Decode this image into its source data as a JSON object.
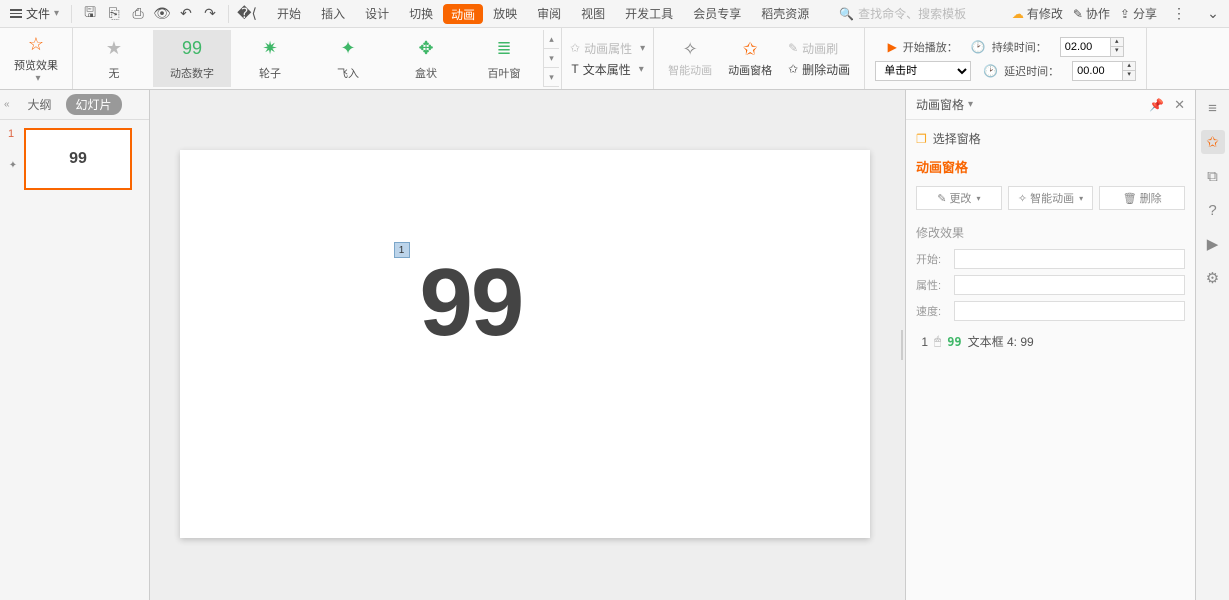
{
  "topbar": {
    "file": "文件",
    "tabs": [
      "开始",
      "插入",
      "设计",
      "切换",
      "动画",
      "放映",
      "审阅",
      "视图",
      "开发工具",
      "会员专享",
      "稻壳资源"
    ],
    "active_tab": 4,
    "search_placeholder": "查找命令、搜索模板",
    "cloud": "有修改",
    "coop": "协作",
    "share": "分享"
  },
  "ribbon": {
    "preview": "预览效果",
    "anims": [
      {
        "label": "无",
        "icon": "★",
        "cls": "none"
      },
      {
        "label": "动态数字",
        "icon": "99",
        "cls": "sel"
      },
      {
        "label": "轮子",
        "icon": "✷",
        "cls": ""
      },
      {
        "label": "飞入",
        "icon": "✦",
        "cls": ""
      },
      {
        "label": "盒状",
        "icon": "✥",
        "cls": ""
      },
      {
        "label": "百叶窗",
        "icon": "≣",
        "cls": ""
      }
    ],
    "anim_prop": "动画属性",
    "text_prop": "文本属性",
    "smart_anim": "智能动画",
    "anim_pane": "动画窗格",
    "del_anim": "删除动画",
    "anim_brush": "动画刷",
    "start_play": "开始播放：",
    "duration": "持续时间：",
    "delay": "延迟时间：",
    "trigger_sel": "单击时",
    "duration_val": "02.00",
    "delay_val": "00.00"
  },
  "outline": {
    "tab1": "大纲",
    "tab2": "幻灯片",
    "slide_num": "1",
    "thumb_text": "99"
  },
  "slide": {
    "tag": "1",
    "text": "99"
  },
  "pane": {
    "title": "动画窗格",
    "select_pane": "选择窗格",
    "section": "动画窗格",
    "btn_change": "更改",
    "btn_smart": "智能动画",
    "btn_delete": "删除",
    "mod_effect": "修改效果",
    "lbl_start": "开始:",
    "lbl_prop": "属性:",
    "lbl_speed": "速度:",
    "item_idx": "1",
    "item_text": "文本框 4: 99"
  }
}
